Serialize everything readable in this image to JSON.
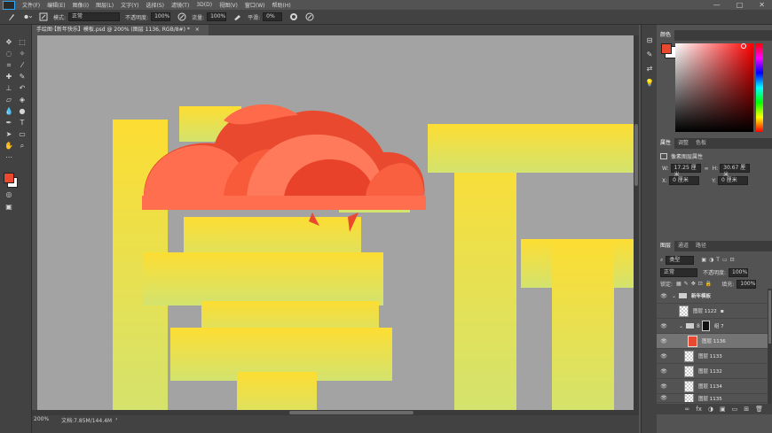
{
  "menubar": {
    "items": [
      "文件(F)",
      "编辑(E)",
      "图像(I)",
      "图层(L)",
      "文字(Y)",
      "选择(S)",
      "滤镜(T)",
      "3D(D)",
      "视图(V)",
      "窗口(W)",
      "帮助(H)"
    ],
    "window_controls": [
      "—",
      "□",
      "✕"
    ]
  },
  "options": {
    "mode_label": "模式:",
    "mode_value": "正常",
    "opacity_label": "不透明度:",
    "opacity_value": "100%",
    "flow_label": "流量:",
    "flow_value": "100%",
    "smooth_label": "平滑:",
    "smooth_value": "0%"
  },
  "document": {
    "tab_title": "手绘图·【新年快乐】模板.psd @ 200% (图层 1136, RGB/8#) *",
    "close_glyph": "×",
    "zoom": "200%",
    "doc_size": "文档:7.85M/144.4M"
  },
  "color_panel": {
    "tab": "颜色",
    "foreground": "#e8492f",
    "background": "#ffffff"
  },
  "properties_panel": {
    "tabs": [
      "属性",
      "调整",
      "色板"
    ],
    "title": "像素图层属性",
    "w_label": "W:",
    "w_value": "17.25 厘米",
    "h_label": "H:",
    "h_value": "30.67 厘米",
    "x_label": "X:",
    "x_value": "0 厘米",
    "y_label": "Y:",
    "y_value": "0 厘米",
    "link_glyph": "∞"
  },
  "layers_panel": {
    "tabs": [
      "图层",
      "通道",
      "路径"
    ],
    "filter_value": "类型",
    "blend_value": "正常",
    "opacity_label": "不透明度:",
    "opacity_value": "100%",
    "lock_label": "锁定:",
    "fill_label": "填充:",
    "fill_value": "100%",
    "layers": [
      {
        "name": "新年模板",
        "visible": true,
        "type": "group"
      },
      {
        "name": "图层 1122",
        "visible": false,
        "type": "pixel"
      },
      {
        "name": "组 7",
        "visible": true,
        "type": "group"
      },
      {
        "name": "图层 1136",
        "visible": true,
        "type": "pixel",
        "selected": true
      },
      {
        "name": "图层 1133",
        "visible": true,
        "type": "pixel"
      },
      {
        "name": "图层 1132",
        "visible": true,
        "type": "pixel"
      },
      {
        "name": "图层 1134",
        "visible": true,
        "type": "pixel"
      },
      {
        "name": "图层 1135",
        "visible": true,
        "type": "pixel"
      }
    ],
    "bottom_icons": [
      "∞",
      "fx",
      "◑",
      "▣",
      "▭",
      "⊞",
      "🗑"
    ]
  },
  "colors": {
    "accent_red": "#e8492f",
    "cloud_light": "#ff7a5a",
    "text_yellow": "#fddd32",
    "text_green": "#d3e36e"
  }
}
